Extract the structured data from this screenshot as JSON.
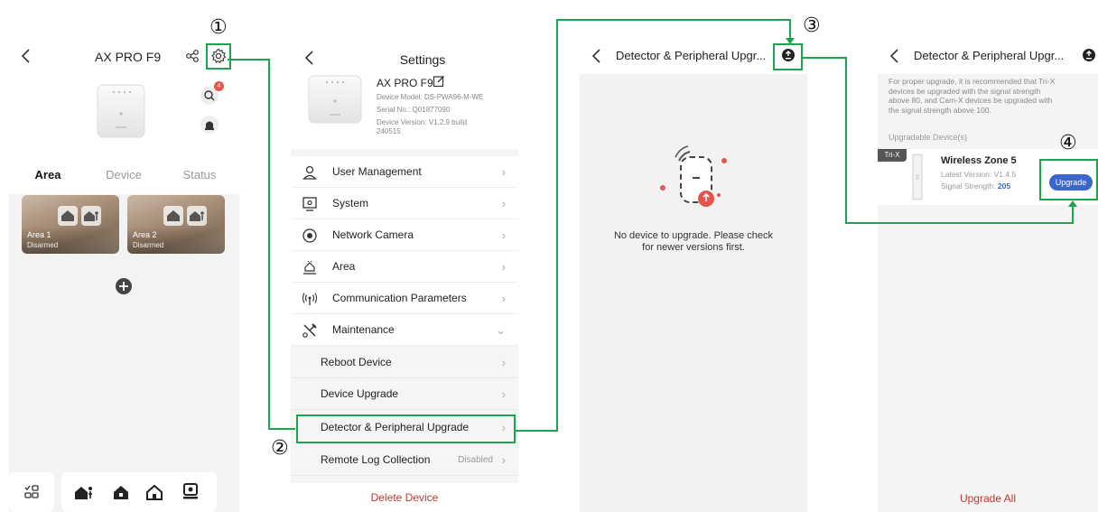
{
  "colors": {
    "annotation_green": "#1ea44d",
    "primary_blue": "#3a67c9",
    "danger_red": "#c0392b",
    "badge_red": "#e2574c"
  },
  "annotations": [
    "①",
    "②",
    "③",
    "④"
  ],
  "screen_home": {
    "title": "AX PRO F9",
    "back_icon": "back-chevron-icon",
    "share_icon": "share-icon",
    "settings_icon": "gear-icon",
    "badge_count": "4",
    "tabs": [
      "Area",
      "Device",
      "Status"
    ],
    "active_tab": "Area",
    "areas": [
      {
        "name": "Area 1",
        "status": "Disarmed"
      },
      {
        "name": "Area 2",
        "status": "Disarmed"
      }
    ],
    "add_icon": "plus-circle-icon",
    "bottom_bar_icons": [
      "multi-select-icon",
      "stay-arm-icon",
      "away-arm-icon",
      "disarm-icon",
      "alarm-icon"
    ]
  },
  "screen_settings": {
    "title": "Settings",
    "device_name": "AX PRO F9",
    "device_model": "Device Model: DS-PWA96-M-WE",
    "serial_no": "Serial No.: Q01877090",
    "device_version_line1": "Device Version: V1.2.9 build",
    "device_version_line2": "240515",
    "menu": [
      {
        "label": "User Management",
        "icon": "user-icon"
      },
      {
        "label": "System",
        "icon": "system-icon"
      },
      {
        "label": "Network Camera",
        "icon": "camera-icon"
      },
      {
        "label": "Area",
        "icon": "area-icon"
      },
      {
        "label": "Communication Parameters",
        "icon": "antenna-icon"
      },
      {
        "label": "Maintenance",
        "icon": "tools-icon"
      }
    ],
    "maintenance_items": [
      {
        "label": "Reboot Device",
        "value": ""
      },
      {
        "label": "Device Upgrade",
        "value": ""
      },
      {
        "label": "Detector & Peripheral Upgrade",
        "value": ""
      },
      {
        "label": "Remote Log Collection",
        "value": "Disabled"
      }
    ],
    "delete_label": "Delete Device"
  },
  "screen_detector_empty": {
    "title": "Detector & Peripheral Upgr...",
    "message_line1": "No device to upgrade. Please check",
    "message_line2": "for newer versions first."
  },
  "screen_detector_list": {
    "title": "Detector & Peripheral Upgr...",
    "note_lines": [
      "For proper upgrade, it is recommended that Tri-X",
      "devices be upgraded with the signal strength",
      "above 80, and Cam-X devices be upgraded with",
      "the signal strength above 100."
    ],
    "section_label": "Upgradable Device(s)",
    "device": {
      "tag": "Tri-X",
      "name": "Wireless Zone 5",
      "latest_version": "Latest Version: V1.4.5",
      "signal_label": "Signal Strength: ",
      "signal_value": "205"
    },
    "upgrade_label": "Upgrade",
    "upgrade_all_label": "Upgrade All"
  }
}
